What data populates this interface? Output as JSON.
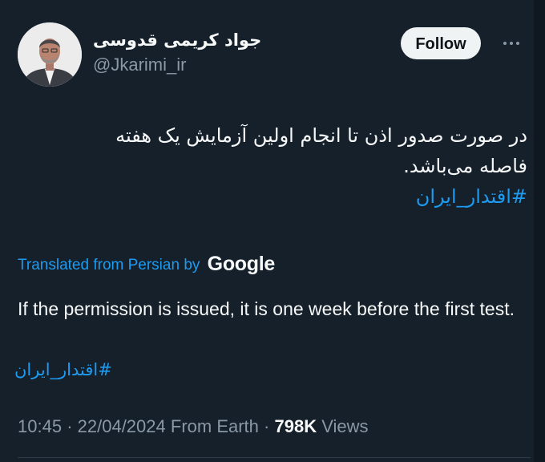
{
  "author": {
    "display_name": "جواد کریمی قدوسی",
    "handle": "@Jkarimi_ir",
    "avatar_icon": "user-portrait-avatar"
  },
  "actions": {
    "follow_label": "Follow",
    "more_icon": "more-options-icon"
  },
  "tweet": {
    "text_line1": "در صورت صدور اذن تا انجام اولین آزمایش یک هفته",
    "text_line2": "فاصله می‌باشد.",
    "hashtag": "#اقتدار_ایران"
  },
  "translation": {
    "label": "Translated from Persian by",
    "provider": "Google",
    "text": "If the permission is issued, it is one week before the first test.",
    "hashtag": "#اقتدار_ایران"
  },
  "meta": {
    "time": "10:45",
    "date": "22/04/2024",
    "location": "From Earth",
    "views_count": "798K",
    "views_label": "Views"
  },
  "colors": {
    "background": "#15202b",
    "accent": "#1d9bf0",
    "text_primary": "#f7f9f9",
    "text_secondary": "#8b98a5",
    "follow_button_bg": "#eff3f4"
  }
}
